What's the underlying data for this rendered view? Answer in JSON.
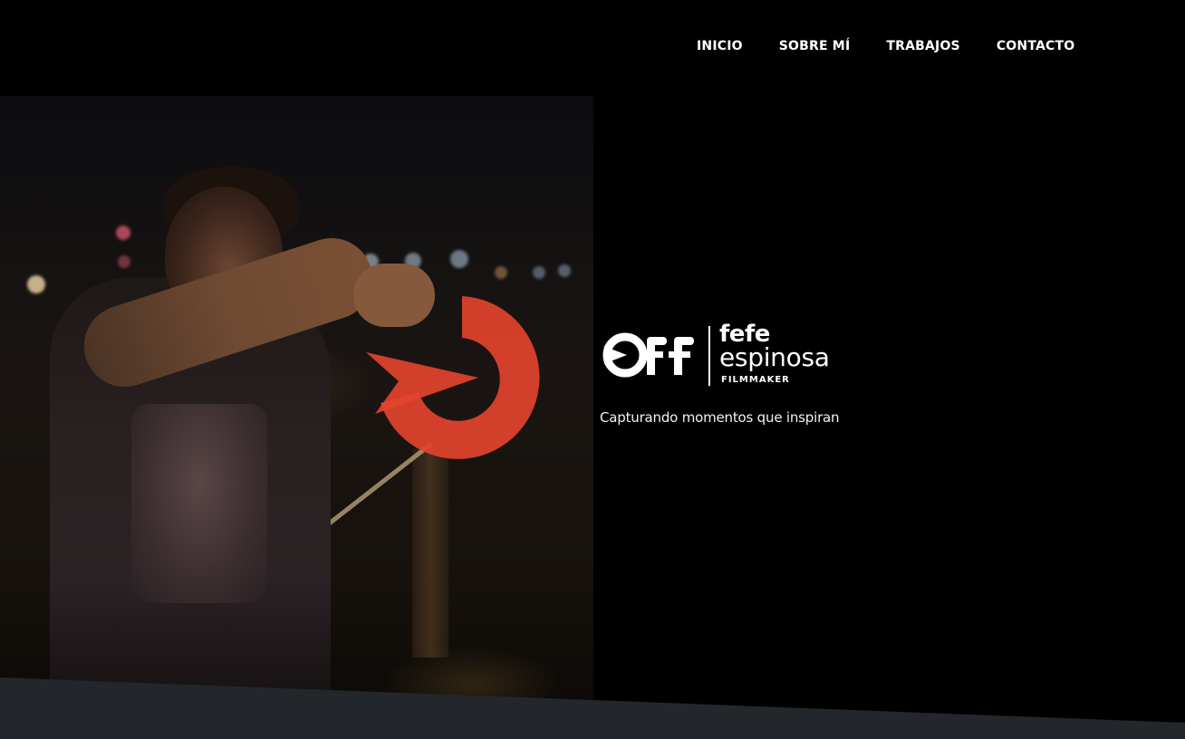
{
  "nav": {
    "links": [
      {
        "label": "INICIO"
      },
      {
        "label": "SOBRE MÍ"
      },
      {
        "label": "TRABAJOS"
      },
      {
        "label": "CONTACTO"
      }
    ]
  },
  "hero": {
    "logo": {
      "mark_text": "Off",
      "name_line1": "fefe",
      "name_line2": "espinosa",
      "role": "FILMMAKER"
    },
    "tagline": "Capturando momentos que inspiran",
    "photo_icon": "photographer-photo",
    "mark_icon": "play-circle-icon"
  },
  "colors": {
    "background": "#000000",
    "accent": "#e2432d",
    "text": "#ffffff",
    "footer_band": "#23262b"
  }
}
